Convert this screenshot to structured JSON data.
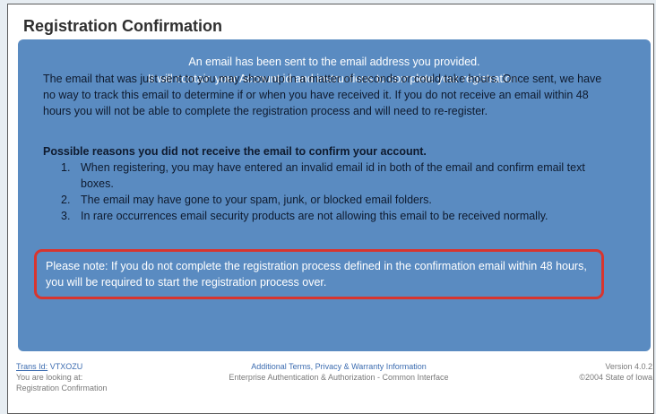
{
  "page": {
    "title": "Registration Confirmation"
  },
  "panel": {
    "intro_line1": "An email has been sent to the email address you provided.",
    "intro_line2": "It will contain your Account id and instructions to complete your registration.",
    "body": "The email that was just sent to you may show up in a matter of seconds or could take hours. Once sent, we have no way to track this email to determine if or when you have received it. If you do not receive an email within 48 hours you will not be able to complete the registration process and will need to re-register.",
    "reasons_heading": "Possible reasons you did not receive the email to confirm your account.",
    "reasons": [
      {
        "num": "1.",
        "text": "When registering, you may have entered an invalid email id in both of the email and confirm email text boxes."
      },
      {
        "num": "2.",
        "text": "The email may have gone to your spam, junk, or blocked email folders."
      },
      {
        "num": "3.",
        "text": "In rare occurrences email security products are not allowing this email to be received normally."
      }
    ],
    "note": "Please note: If you do not complete the registration process defined in the confirmation email within 48 hours, you will be required to start the registration process over."
  },
  "footer": {
    "trans_label": "Trans Id:",
    "trans_id": "VTXOZU",
    "looking_label": "You are looking at:",
    "looking_value": "Registration Confirmation",
    "terms_link": "Additional Terms, Privacy & Warranty Information",
    "service_name": "Enterprise Authentication & Authorization - Common Interface",
    "version_label": "Version",
    "version_value": "4.0.2",
    "copyright": "©2004 State of Iowa"
  },
  "colors": {
    "panel_bg": "#5a8bc1",
    "note_border": "#d8352f",
    "link": "#3c6cb0"
  }
}
